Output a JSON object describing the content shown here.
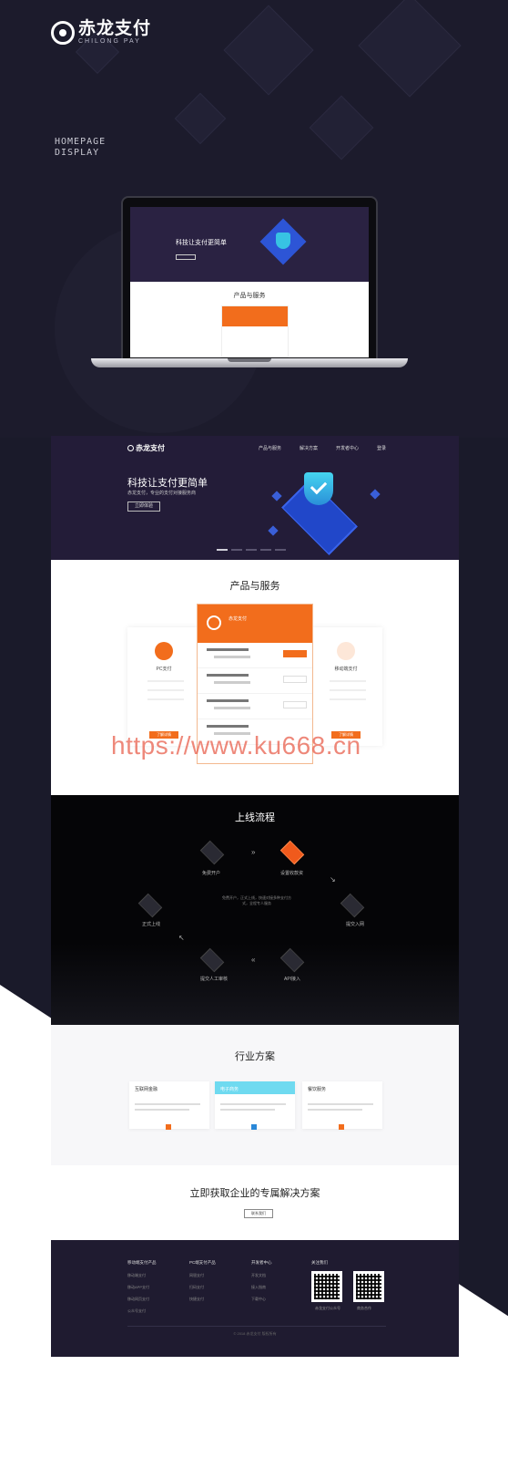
{
  "brand": {
    "name_cn": "赤龙支付",
    "name_en": "CHILONG PAY"
  },
  "label": {
    "line1": "HOMEPAGE",
    "line2": "DISPLAY"
  },
  "laptop": {
    "hero_title": "科技让支付更简单",
    "section_title": "产品与服务"
  },
  "site": {
    "logo": "赤龙支付",
    "nav": [
      "产品与服务",
      "解决方案",
      "开发者中心",
      "登录"
    ],
    "hero_title": "科技让支付更简单",
    "hero_sub": "赤龙支付，专业的支付对接服务商",
    "hero_button": "立即体验",
    "products_title": "产品与服务",
    "left_card": {
      "name": "PC支付",
      "button": "了解详情"
    },
    "right_card": {
      "name": "移动端支付",
      "button": "了解详情"
    },
    "center_card": {
      "title": "赤龙支付"
    },
    "flow_title": "上线流程",
    "flow_nodes": [
      "免费开户",
      "设置收款资",
      "提交入网",
      "正式上线",
      "提交人工审核",
      "API接入"
    ],
    "flow_text": "免费开户，正式上线，快速对接多种支付方式，全程专人服务",
    "industry_title": "行业方案",
    "industry_cards": [
      "互联网金融",
      "电子商务",
      "餐饮服务"
    ],
    "cta_title": "立即获取企业的专属解决方案",
    "cta_button": "联系我们",
    "footer_cols": [
      {
        "head": "移动端支付产品",
        "items": [
          "移动端支付",
          "移动APP支付",
          "移动网页支付",
          "公众号支付"
        ]
      },
      {
        "head": "PC端支付产品",
        "items": [
          "网银支付",
          "扫码支付",
          "快捷支付"
        ]
      },
      {
        "head": "开发者中心",
        "items": [
          "开发文档",
          "接入指南",
          "下载中心"
        ]
      },
      {
        "head": "关注我们",
        "items": []
      }
    ],
    "qr_labels": [
      "赤龙支付公众号",
      "商务合作"
    ],
    "copyright": "© 2018 赤龙支付 版权所有"
  },
  "watermark": "https://www.ku668.cn"
}
